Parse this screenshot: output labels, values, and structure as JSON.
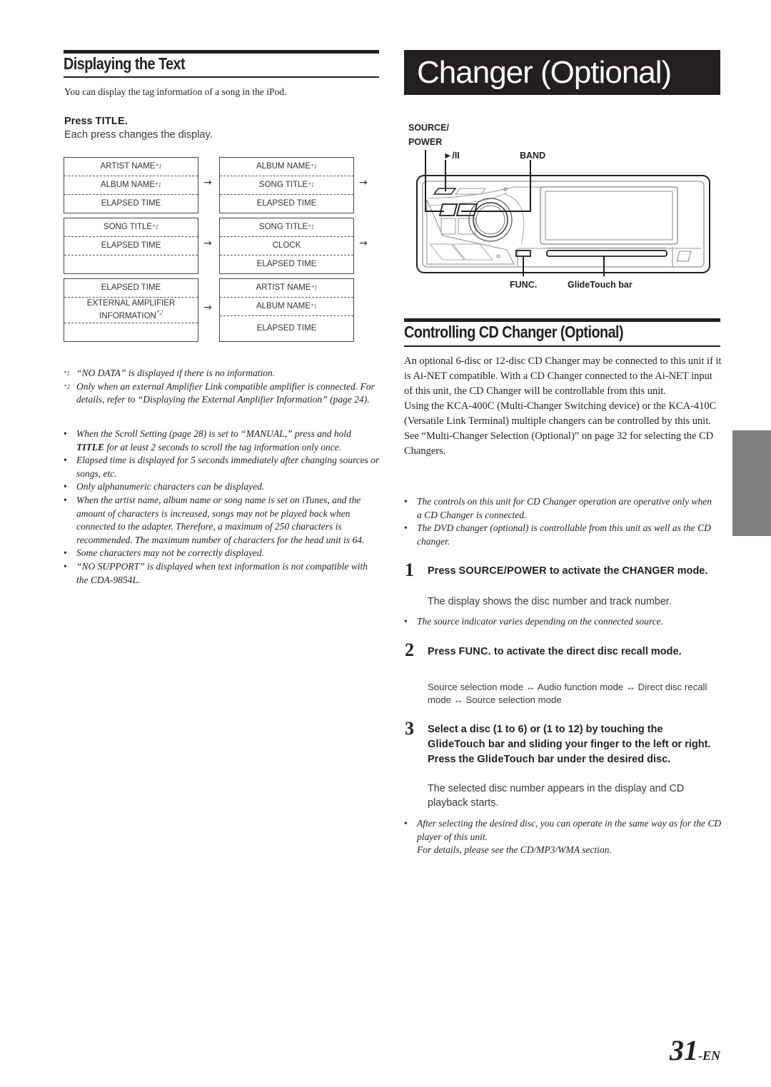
{
  "left": {
    "heading": "Displaying the Text",
    "intro": "You can display the tag information of a song in the iPod.",
    "press_prefix": "Press ",
    "press_key": "TITLE",
    "press_suffix": ".",
    "press_desc": "Each press changes the display.",
    "display_boxes": [
      {
        "rows": [
          {
            "text": "ARTIST NAME",
            "mark": "*1"
          },
          {
            "text": "ALBUM NAME",
            "mark": "*1"
          },
          {
            "text": "ELAPSED TIME",
            "mark": ""
          }
        ]
      },
      {
        "rows": [
          {
            "text": "ALBUM NAME",
            "mark": "*1"
          },
          {
            "text": "SONG TITLE",
            "mark": "*1"
          },
          {
            "text": "ELAPSED TIME",
            "mark": ""
          }
        ]
      },
      {
        "rows": [
          {
            "text": "SONG TITLE",
            "mark": "*1"
          },
          {
            "text": "ELAPSED TIME",
            "mark": ""
          },
          {
            "text": "",
            "mark": ""
          }
        ]
      },
      {
        "rows": [
          {
            "text": "SONG TITLE",
            "mark": "*1"
          },
          {
            "text": "CLOCK",
            "mark": ""
          },
          {
            "text": "ELAPSED TIME",
            "mark": ""
          }
        ]
      },
      {
        "rows": [
          {
            "text": "ELAPSED TIME",
            "mark": ""
          },
          {
            "text": "EXTERNAL AMPLIFIER INFORMATION",
            "mark": "*2"
          },
          {
            "text": "",
            "mark": ""
          }
        ]
      },
      {
        "rows": [
          {
            "text": "ARTIST NAME",
            "mark": "*1"
          },
          {
            "text": "ALBUM NAME",
            "mark": "*1"
          },
          {
            "text": "ELAPSED TIME",
            "mark": ""
          }
        ]
      }
    ],
    "arrow": "→",
    "footnotes": [
      {
        "mark": "*1",
        "text": "“NO DATA” is displayed if there is no information."
      },
      {
        "mark": "*2",
        "text": "Only when an external Amplifier Link compatible amplifier is connected. For details, refer to “Displaying the External Amplifier Information” (page 24)."
      }
    ],
    "bullets": [
      {
        "pre": "When the Scroll Setting (page 28) is set to “MANUAL,” press and hold ",
        "bold": "TITLE",
        "post": "  for at least 2 seconds to scroll the tag information only once."
      },
      {
        "pre": "Elapsed time is displayed for 5 seconds immediately after changing sources or songs, etc.",
        "bold": "",
        "post": ""
      },
      {
        "pre": "Only alphanumeric characters can be displayed.",
        "bold": "",
        "post": ""
      },
      {
        "pre": "When the artist name, album name or song name is set on iTunes, and the amount of characters is increased, songs may not be played back when connected to the adapter. Therefore, a maximum of 250 characters is recommended. The maximum number of characters for the head unit is 64.",
        "bold": "",
        "post": ""
      },
      {
        "pre": "Some characters may not be correctly displayed.",
        "bold": "",
        "post": ""
      },
      {
        "pre": "“NO SUPPORT” is displayed when text information is not compatible with the CDA-9854L.",
        "bold": "",
        "post": ""
      }
    ],
    "bullet_glyph": "•"
  },
  "right": {
    "chapter_title": "Changer (Optional)",
    "diagram": {
      "label_source_power": "SOURCE/\nPOWER",
      "label_source": "SOURCE/",
      "label_power": "POWER",
      "label_play_pause": "►/II",
      "label_band": "BAND",
      "label_func": "FUNC.",
      "label_glidetouch": "GlideTouch bar"
    },
    "heading": "Controlling CD Changer (Optional)",
    "paragraphs": [
      "An optional 6-disc or 12-disc CD Changer may be connected to this unit if it is Ai-NET compatible. With a CD Changer connected to the Ai-NET input of this unit, the CD Changer will be controllable from this unit.",
      "Using the KCA-400C (Multi-Changer Switching device) or the KCA-410C (Versatile Link Terminal) multiple changers can be controlled by this unit.",
      "See “Multi-Changer Selection (Optional)” on page 32 for selecting the CD Changers."
    ],
    "bullets": [
      "The controls on this unit for CD Changer operation are operative only when a CD Changer is connected.",
      "The DVD changer (optional) is controllable from this unit as well as the CD changer."
    ],
    "steps": [
      {
        "num": "1",
        "title_pre": "Press ",
        "title_key": "SOURCE/POWER",
        "title_post": " to activate the CHANGER mode.",
        "desc": "The display shows the disc number and track number.",
        "notes": [
          "The source indicator varies depending on the connected source."
        ]
      },
      {
        "num": "2",
        "title_pre": "Press ",
        "title_key": "FUNC.",
        "title_post": " to activate the direct disc recall mode.",
        "desc": "Source selection mode ↔ Audio function mode ↔ Direct disc recall mode ↔ Source selection mode",
        "notes": []
      },
      {
        "num": "3",
        "title_part1": "Select a disc (1 to 6)  or (1 to 12) by touching the ",
        "title_key1": "GlideTouch bar",
        "title_part2": " and sliding your finger to the left or right. Press the ",
        "title_key2": "GlideTouch bar",
        "title_part3": " under the desired disc.",
        "desc": "The selected disc number appears in the display and CD playback starts.",
        "notes": [
          "After selecting the desired disc, you can operate in the same way as for the CD player of this unit."
        ],
        "extra_note": "For details, please see the CD/MP3/WMA section."
      }
    ]
  },
  "footer": {
    "page_number": "31",
    "page_suffix": "-EN"
  }
}
